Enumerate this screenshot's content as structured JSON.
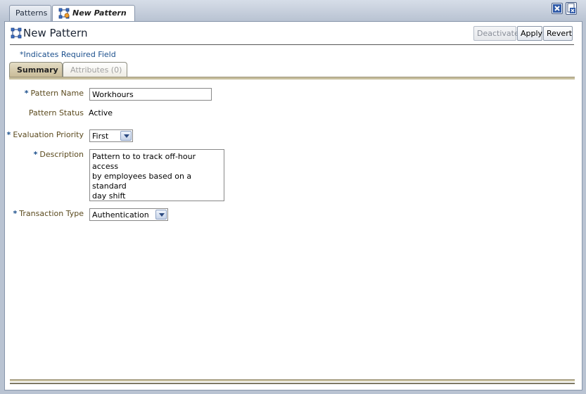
{
  "document_tabs": [
    {
      "label": "Patterns",
      "active": false
    },
    {
      "label": "New Pattern",
      "active": true
    }
  ],
  "window_controls": {
    "close_icon": "close-tab-icon",
    "close_all_icon": "close-all-icon"
  },
  "header": {
    "title": "New Pattern",
    "icon": "pattern-icon",
    "buttons": {
      "deactivate": "Deactivate",
      "apply": "Apply",
      "revert": "Revert"
    }
  },
  "required_note": "*Indicates Required Field",
  "subtabs": [
    {
      "label": "Summary",
      "selected": true
    },
    {
      "label": "Attributes (0)",
      "selected": false
    }
  ],
  "form": {
    "required_marker": "*",
    "pattern_name": {
      "label": "Pattern Name",
      "value": "Workhours",
      "required": true
    },
    "pattern_status": {
      "label": "Pattern Status",
      "value": "Active",
      "required": false
    },
    "evaluation_priority": {
      "label": "Evaluation Priority",
      "value": "First",
      "required": true
    },
    "description": {
      "label": "Description",
      "value": "Pattern to to track off-hour access\nby employees based on a standard\nday shift",
      "required": true
    },
    "transaction_type": {
      "label": "Transaction Type",
      "value": "Authentication",
      "required": true
    }
  },
  "colors": {
    "background": "#b9c3d2",
    "label": "#5b4a1e",
    "required": "#1b4f8c",
    "tab_selected": "#c9bc98"
  }
}
